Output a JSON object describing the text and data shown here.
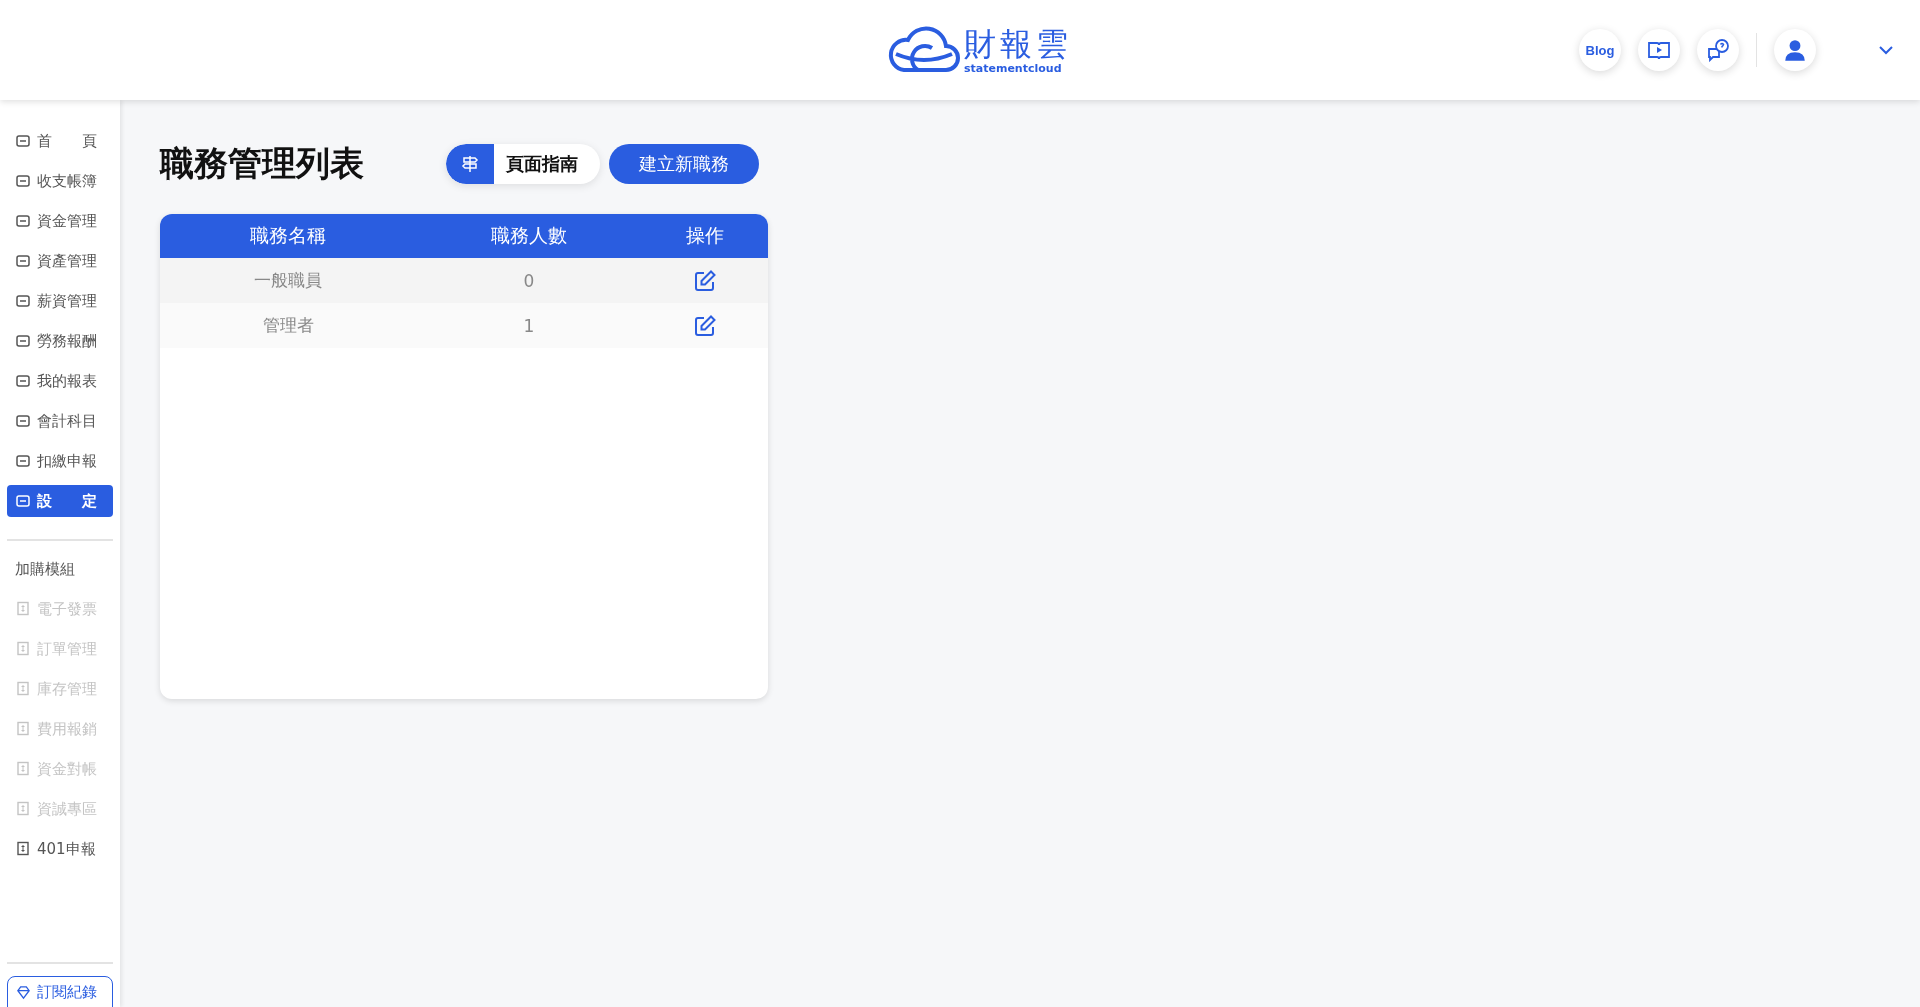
{
  "header": {
    "logo_text": "財報雲",
    "logo_subtext": "statementcloud",
    "blog_label": "Blog"
  },
  "sidebar": {
    "items": [
      {
        "label": "首　　頁",
        "kind": "main",
        "selected": false,
        "disabled": false
      },
      {
        "label": "收支帳簿",
        "kind": "main",
        "selected": false,
        "disabled": false
      },
      {
        "label": "資金管理",
        "kind": "main",
        "selected": false,
        "disabled": false
      },
      {
        "label": "資產管理",
        "kind": "main",
        "selected": false,
        "disabled": false
      },
      {
        "label": "薪資管理",
        "kind": "main",
        "selected": false,
        "disabled": false
      },
      {
        "label": "勞務報酬",
        "kind": "main",
        "selected": false,
        "disabled": false
      },
      {
        "label": "我的報表",
        "kind": "main",
        "selected": false,
        "disabled": false
      },
      {
        "label": "會計科目",
        "kind": "main",
        "selected": false,
        "disabled": false
      },
      {
        "label": "扣繳申報",
        "kind": "main",
        "selected": false,
        "disabled": false
      },
      {
        "label": "設　　定",
        "kind": "main",
        "selected": true,
        "disabled": false
      }
    ],
    "section_title": "加購模組",
    "modules": [
      {
        "label": "電子發票",
        "selected": false,
        "disabled": true
      },
      {
        "label": "訂單管理",
        "selected": false,
        "disabled": true
      },
      {
        "label": "庫存管理",
        "selected": false,
        "disabled": true
      },
      {
        "label": "費用報銷",
        "selected": false,
        "disabled": true
      },
      {
        "label": "資金對帳",
        "selected": false,
        "disabled": true
      },
      {
        "label": "資誠專區",
        "selected": false,
        "disabled": true
      },
      {
        "label": "401申報",
        "selected": false,
        "disabled": false
      }
    ],
    "subscription_button": "訂閱紀錄"
  },
  "page": {
    "title": "職務管理列表",
    "guide_button": "頁面指南",
    "create_button": "建立新職務"
  },
  "table": {
    "columns": [
      "職務名稱",
      "職務人數",
      "操作"
    ],
    "rows": [
      {
        "name": "一般職員",
        "count": "0"
      },
      {
        "name": "管理者",
        "count": "1"
      }
    ]
  }
}
